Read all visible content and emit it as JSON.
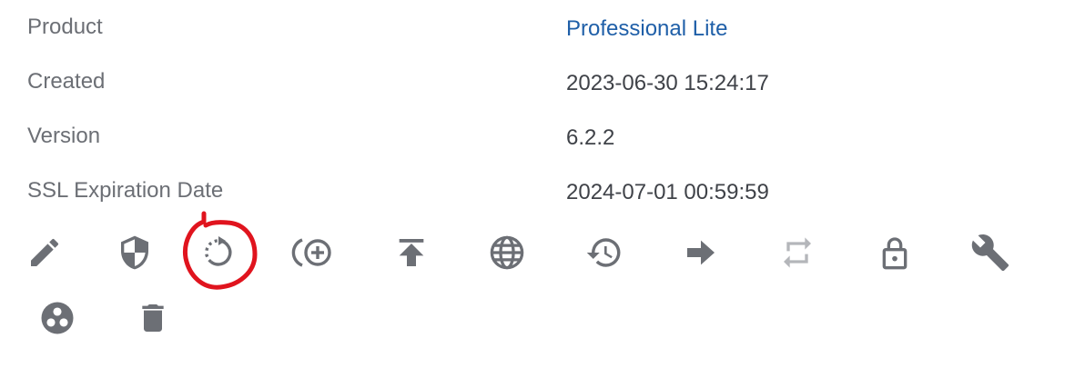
{
  "details": {
    "rows": [
      {
        "label": "Product",
        "value": "Professional Lite"
      },
      {
        "label": "Created",
        "value": "2023-06-30 15:24:17"
      },
      {
        "label": "Version",
        "value": "6.2.2"
      },
      {
        "label": "SSL Expiration Date",
        "value": "2024-07-01 00:59:59"
      }
    ]
  },
  "toolbar": {
    "icons": [
      "edit-icon",
      "shield-icon",
      "restart-icon",
      "add-addon-icon",
      "upload-icon",
      "globe-icon",
      "history-icon",
      "forward-arrow-icon",
      "sync-icon",
      "lock-icon",
      "wrench-icon",
      "community-icon",
      "delete-icon"
    ]
  },
  "colors": {
    "label": "#6c6f75",
    "value": "#3f4248",
    "link": "#1f5fa8",
    "icon": "#6c6f75",
    "icon_disabled": "#b4b6ba",
    "annotation": "#e0141e"
  }
}
